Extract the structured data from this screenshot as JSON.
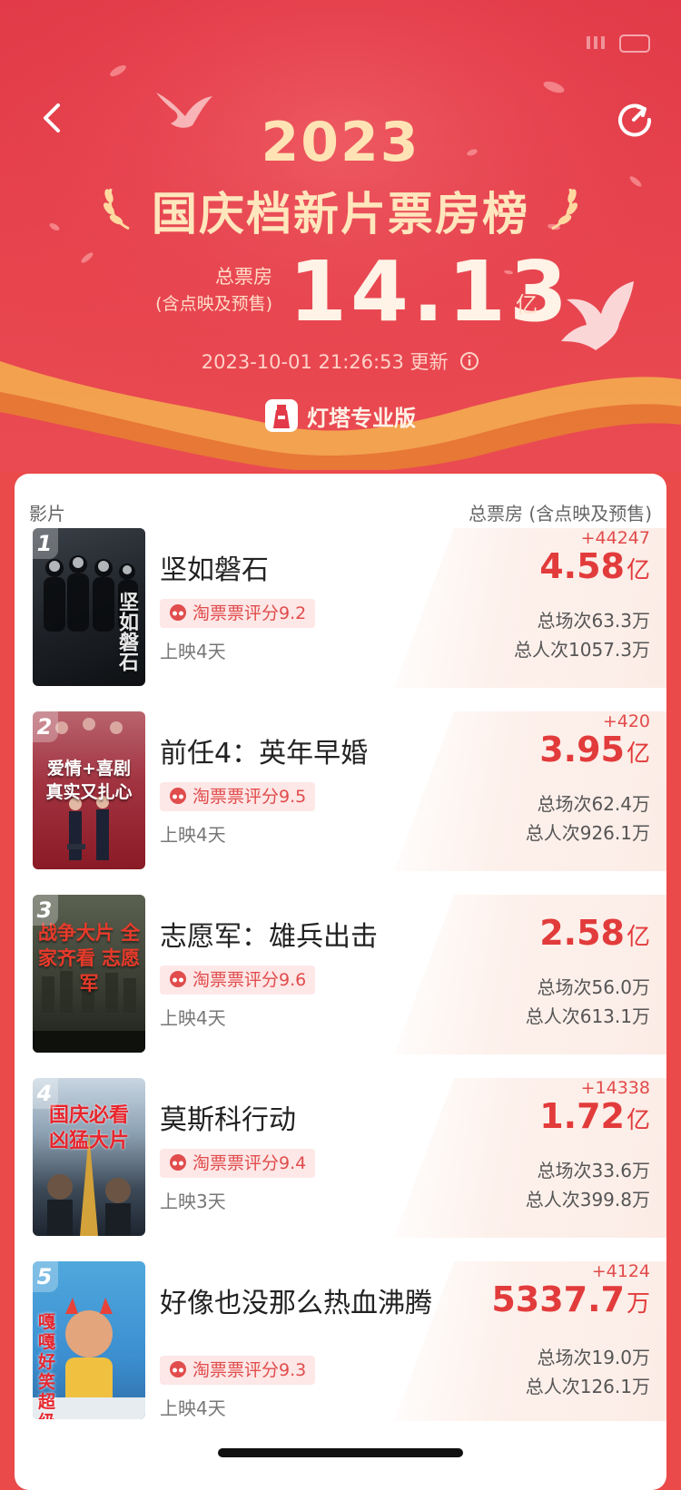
{
  "header": {
    "year": "2023",
    "title": "国庆档新片票房榜",
    "total_label": "总票房",
    "total_sub": "(含点映及预售)",
    "total_value": "14.13",
    "total_unit": "亿",
    "updated_time": "2023-10-01 21:26:53",
    "updated_suffix": "更新",
    "brand": "灯塔专业版"
  },
  "table": {
    "col_left": "影片",
    "col_right": "总票房 (含点映及预售)"
  },
  "films": [
    {
      "rank": "1",
      "title": "坚如磐石",
      "rating": "淘票票评分9.2",
      "days": "上映4天",
      "delta": "+44247",
      "gross": "4.58",
      "unit": "亿",
      "shows": "总场次63.3万",
      "admits": "总人次1057.3万",
      "poster_text": "坚如磐石"
    },
    {
      "rank": "2",
      "title": "前任4：英年早婚",
      "rating": "淘票票评分9.5",
      "days": "上映4天",
      "delta": "+420",
      "gross": "3.95",
      "unit": "亿",
      "shows": "总场次62.4万",
      "admits": "总人次926.1万",
      "poster_text": "爱情+喜剧 真实又扎心"
    },
    {
      "rank": "3",
      "title": "志愿军：雄兵出击",
      "rating": "淘票票评分9.6",
      "days": "上映4天",
      "delta": "",
      "gross": "2.58",
      "unit": "亿",
      "shows": "总场次56.0万",
      "admits": "总人次613.1万",
      "poster_text": "战争大片 全家齐看 志愿军"
    },
    {
      "rank": "4",
      "title": "莫斯科行动",
      "rating": "淘票票评分9.4",
      "days": "上映3天",
      "delta": "+14338",
      "gross": "1.72",
      "unit": "亿",
      "shows": "总场次33.6万",
      "admits": "总人次399.8万",
      "poster_text": "国庆必看 凶猛大片"
    },
    {
      "rank": "5",
      "title": "好像也没那么热血沸腾",
      "rating": "淘票票评分9.3",
      "days": "上映4天",
      "delta": "+4124",
      "gross": "5337.7",
      "unit": "万",
      "shows": "总场次19.0万",
      "admits": "总人次126.1万",
      "poster_text": "嘎嘎好笑 超级温暖"
    }
  ],
  "colors": {
    "accent": "#e23b3b",
    "header_bg": "#e6424d",
    "gold": "#ffe3b5"
  }
}
